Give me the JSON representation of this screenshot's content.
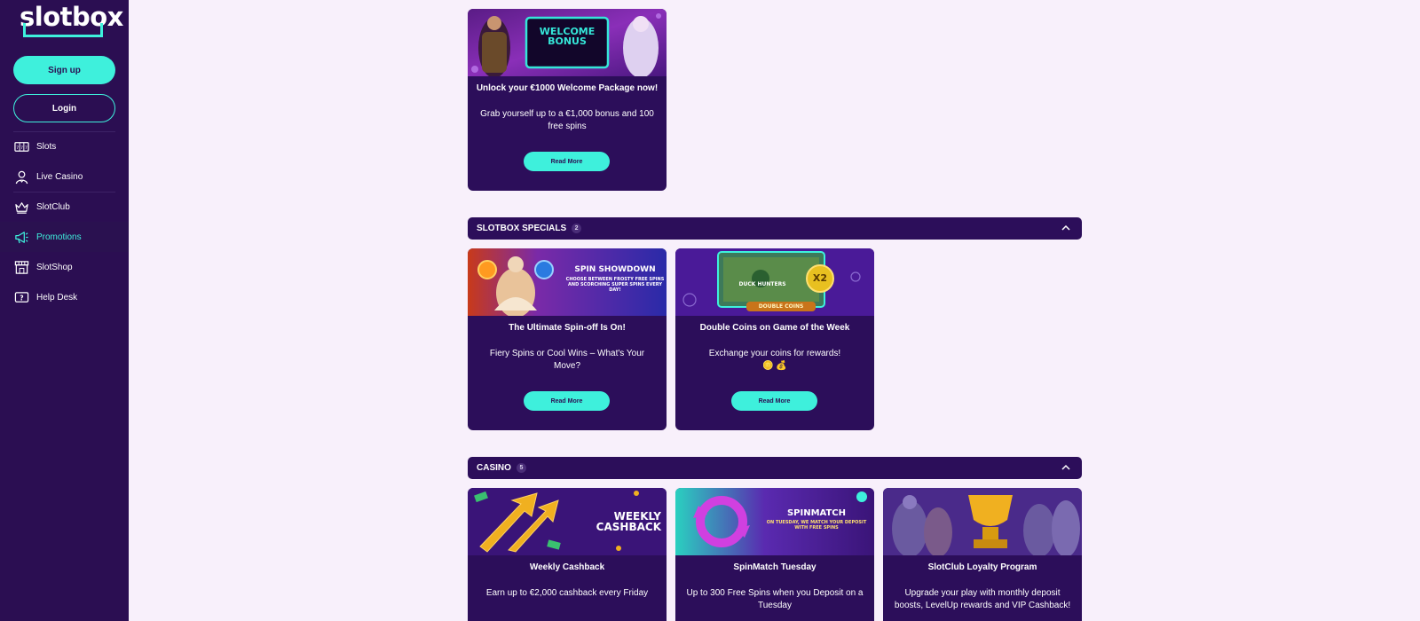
{
  "brand": {
    "logo_text": "slotbox"
  },
  "sidebar": {
    "signup_label": "Sign up",
    "login_label": "Login",
    "items": [
      {
        "label": "Slots",
        "icon": "slot-machine-icon"
      },
      {
        "label": "Live Casino",
        "icon": "dealer-icon"
      },
      {
        "label": "SlotClub",
        "icon": "crown-icon"
      },
      {
        "label": "Promotions",
        "icon": "megaphone-icon",
        "active": true
      },
      {
        "label": "SlotShop",
        "icon": "shop-icon"
      },
      {
        "label": "Help Desk",
        "icon": "help-icon"
      }
    ]
  },
  "colors": {
    "accent": "#3ef0dc",
    "sidebar_bg": "#2b0e52",
    "card_bg": "#2c0e5a",
    "page_bg": "#f8f0fb"
  },
  "welcome": {
    "banner_text": "WELCOME BONUS",
    "title": "Unlock your €1000 Welcome Package now!",
    "desc": "Grab yourself up to a €1,000 bonus and 100 free spins",
    "cta": "Read More"
  },
  "specials": {
    "heading": "SLOTBOX SPECIALS",
    "count": "2",
    "cards": [
      {
        "banner_title": "SPIN SHOWDOWN",
        "banner_sub": "CHOOSE BETWEEN FROSTY FREE SPINS AND SCORCHING SUPER SPINS EVERY DAY!",
        "title": "The Ultimate Spin-off Is On!",
        "desc": "Fiery Spins or Cool Wins – What's Your Move?",
        "cta": "Read More"
      },
      {
        "banner_title": "DUCK HUNTERS",
        "banner_sub": "DOUBLE COINS",
        "banner_badge": "x2",
        "title": "Double Coins on Game of the Week",
        "desc": "Exchange your coins for rewards!",
        "emoji": "🪙 💰",
        "cta": "Read More"
      }
    ]
  },
  "casino": {
    "heading": "CASINO",
    "count": "5",
    "cards": [
      {
        "banner_title": "WEEKLY CASHBACK",
        "title": "Weekly Cashback",
        "desc": "Earn up to €2,000 cashback every Friday"
      },
      {
        "banner_title": "SPINMATCH",
        "banner_sub": "ON TUESDAY, WE MATCH YOUR DEPOSIT WITH FREE SPINS",
        "title": "SpinMatch Tuesday",
        "desc": "Up to 300 Free Spins when you Deposit on a Tuesday"
      },
      {
        "title": "SlotClub Loyalty Program",
        "desc": "Upgrade your play with monthly deposit boosts, LevelUp rewards and VIP Cashback!"
      }
    ]
  }
}
